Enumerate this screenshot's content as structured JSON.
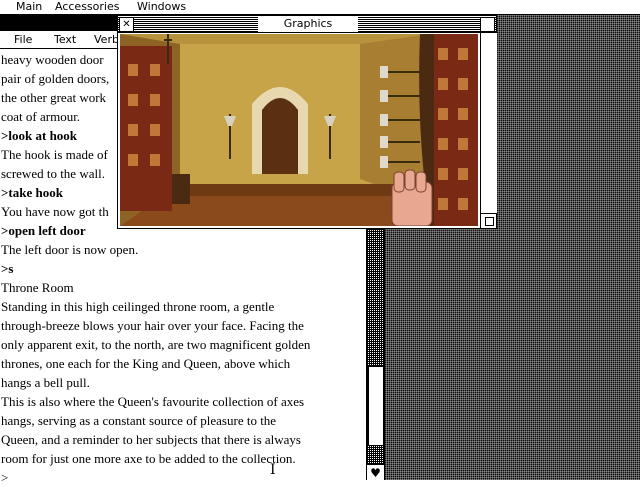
{
  "menubar": {
    "items": [
      "Main",
      "Accessories",
      "Windows"
    ]
  },
  "text_window": {
    "menu": [
      "File",
      "Text",
      "Verb"
    ],
    "lines": [
      {
        "text": "heavy wooden door",
        "cmd": false
      },
      {
        "text": "pair of golden doors,",
        "cmd": false
      },
      {
        "text": "the other great work",
        "cmd": false
      },
      {
        "text": "coat of armour.",
        "cmd": false
      },
      {
        "text": ">look at hook",
        "cmd": true
      },
      {
        "text": "The hook is made of",
        "cmd": false
      },
      {
        "text": "screwed to the wall.",
        "cmd": false
      },
      {
        "text": ">take hook",
        "cmd": true
      },
      {
        "text": "You have now got th",
        "cmd": false
      },
      {
        "text": ">open left door",
        "cmd": true
      },
      {
        "text": "The left door is now open.",
        "cmd": false
      },
      {
        "text": ">s",
        "cmd": true
      },
      {
        "text": "Throne Room",
        "cmd": false
      },
      {
        "text": "Standing in this high ceilinged throne room, a gentle",
        "cmd": false
      },
      {
        "text": "through-breeze blows your hair over your face. Facing the",
        "cmd": false
      },
      {
        "text": "only apparent exit, to the north, are two magnificent golden",
        "cmd": false
      },
      {
        "text": "thrones, one each for the King and Queen, above which",
        "cmd": false
      },
      {
        "text": "hangs a bell pull.",
        "cmd": false
      },
      {
        "text": "This is also where the Queen's favourite collection of axes",
        "cmd": false
      },
      {
        "text": "hangs, serving as a constant source of pleasure to the",
        "cmd": false
      },
      {
        "text": "Queen, and a reminder to her subjects that there is always",
        "cmd": false
      },
      {
        "text": "room for just one more axe to be added to the collection.",
        "cmd": false
      },
      {
        "text": ">",
        "cmd": false
      }
    ]
  },
  "graphics_window": {
    "title": "Graphics",
    "close_glyph": "✕"
  },
  "colors": {
    "wall": "#c8a448",
    "floor": "#8a4a1c",
    "arch": "#e8d8b0",
    "shadow": "#5a3010"
  }
}
